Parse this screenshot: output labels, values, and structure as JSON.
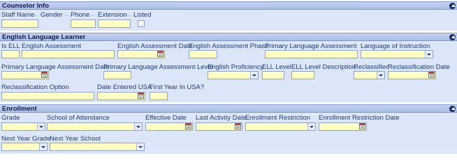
{
  "counselor": {
    "title": "Counselor Info",
    "labels": {
      "staff_name": "Staff Name",
      "gender": "Gender",
      "phone": "Phone",
      "extension": "Extension",
      "listed": "Listed"
    },
    "arrow": "←"
  },
  "ell": {
    "title": "English Language Learner",
    "labels": {
      "is_ell": "Is ELL",
      "english_assessment": "English Assessment",
      "english_assessment_date": "English Assessment Date",
      "english_assessment_phase": "English Assessment Phase",
      "primary_language_assessment": "Primary Language Assessment",
      "language_of_instruction": "Language of Instruction",
      "primary_language_assessment_date": "Primary Language Assessment Date",
      "primary_language_assessment_level": "Primary Language Assessment Level",
      "english_proficiency": "English Proficiency",
      "ell_level": "ELL Level",
      "ell_level_description": "ELL Level Description",
      "reclassified": "Reclassified",
      "reclassification_date": "Reclassification Date",
      "reclassification_option": "Reclassification Option",
      "date_entered_usa": "Date Entered USA",
      "first_year_in_usa": "First Year In USA?"
    }
  },
  "enrollment": {
    "title": "Enrollment",
    "labels": {
      "grade": "Grade",
      "school_of_attendance": "School of Attendance",
      "effective_date": "Effective Date",
      "last_activity_date": "Last Activity Date",
      "enrollment_restriction": "Enrollment Restriction",
      "enrollment_restriction_date": "Enrollment Restriction Date",
      "next_year_grade": "Next Year Grade",
      "next_year_school": "Next Year School"
    }
  },
  "colors": {
    "header": "#a9bde8",
    "panel": "#dbe6f9",
    "field": "#ffffc4",
    "text": "#1e3a78"
  }
}
